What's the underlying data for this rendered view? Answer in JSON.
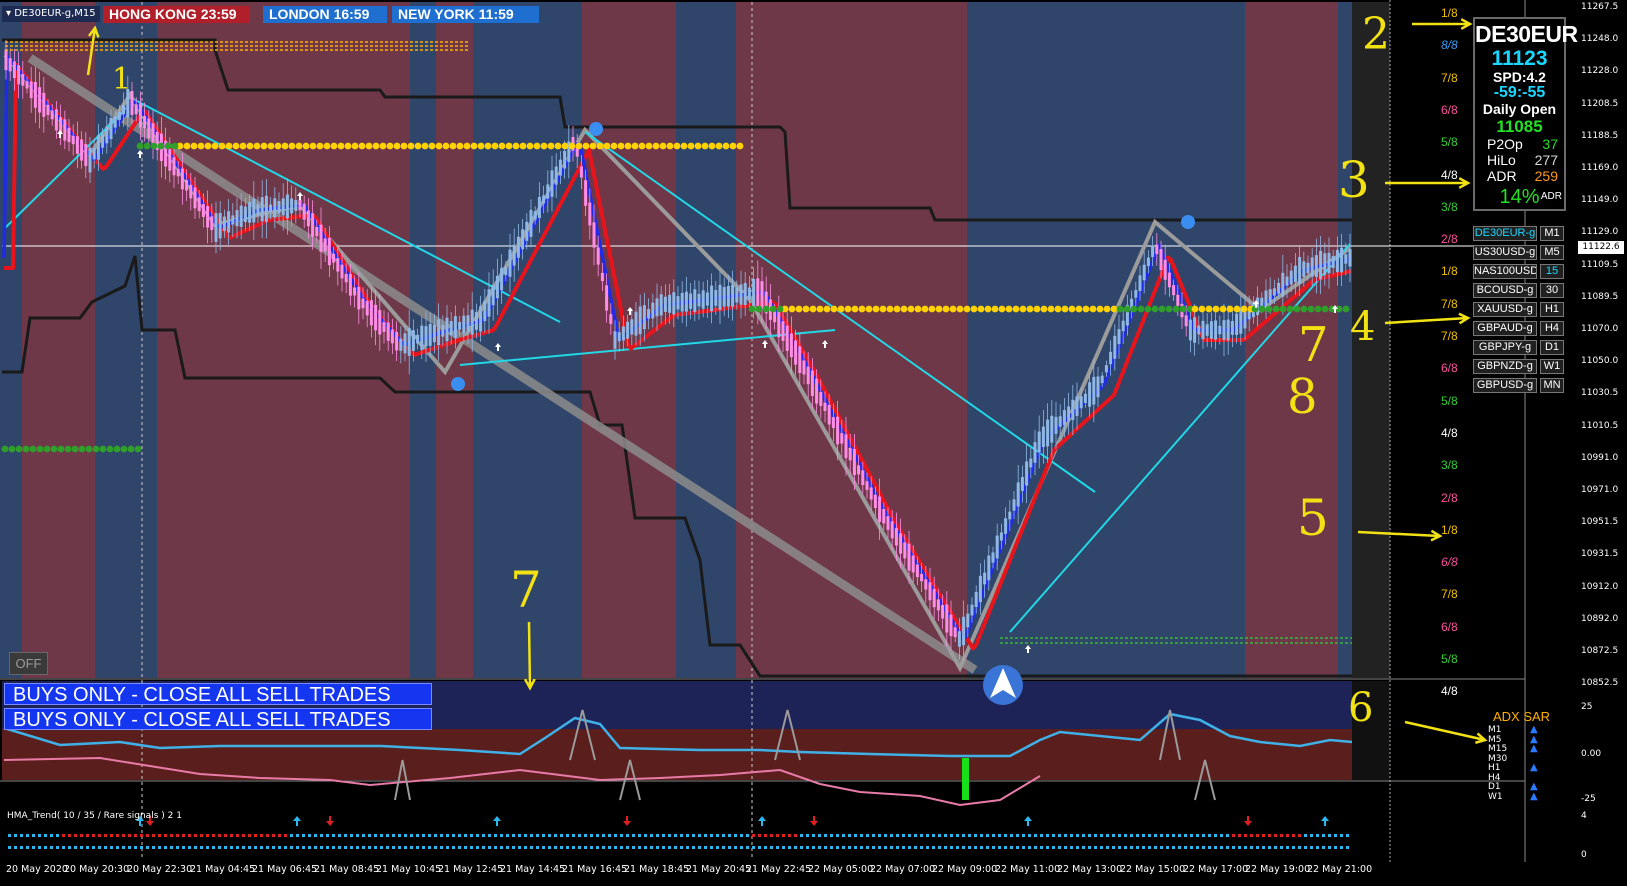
{
  "chart": {
    "symbol_timeframe": "DE30EUR-g,M15",
    "sessions": [
      {
        "city": "HONG KONG",
        "time": "23:59",
        "color": "#b01f2a"
      },
      {
        "city": "LONDON",
        "time": "16:59",
        "color": "#1e6fd0"
      },
      {
        "city": "NEW YORK",
        "time": "11:59",
        "color": "#1e6fd0"
      }
    ],
    "banners": [
      "BUYS ONLY - CLOSE ALL SELL TRADES",
      "BUYS ONLY - CLOSE ALL SELL TRADES"
    ],
    "off_button": "OFF",
    "current_price_tag": "11122.6",
    "colors": {
      "bull_bg": "#2f4569",
      "bear_bg": "#6e3848",
      "red_line": "#e8141c",
      "blue_line": "#1f2be6",
      "gray_line": "#9b9b9b",
      "cyan_line": "#22d7e6",
      "yellow_dots": "#ffd200",
      "green_dots": "#2f9e2a",
      "annotation": "#f2e214"
    }
  },
  "info_panel": {
    "symbol": "DE30EUR",
    "price": "11123",
    "spread": "SPD:4.2",
    "countdown": "-59:-55",
    "daily_open_label": "Daily Open",
    "daily_open_value": "11085",
    "rows": [
      {
        "label": "P2Op",
        "value": "37",
        "color": "#24e024"
      },
      {
        "label": "HiLo",
        "value": "277",
        "color": "#d8d8d8"
      },
      {
        "label": "ADR",
        "value": "259",
        "color": "#ff9a1a"
      }
    ],
    "adr_pct": "14%",
    "adr_suffix": "ADR"
  },
  "symbol_list": [
    "DE30EUR-g",
    "US30USD-g",
    "NAS100USD-g",
    "BCOUSD-g",
    "XAUUSD-g",
    "GBPAUD-g",
    "GBPJPY-g",
    "GBPNZD-g",
    "GBPUSD-g"
  ],
  "timeframes": [
    "M1",
    "M5",
    "15",
    "30",
    "H1",
    "H4",
    "D1",
    "W1",
    "MN"
  ],
  "price_axis": [
    "11267.5",
    "11248.0",
    "11228.0",
    "11208.5",
    "11188.5",
    "11169.0",
    "11149.0",
    "11129.0",
    "11109.5",
    "11089.5",
    "11070.0",
    "11050.0",
    "11030.5",
    "11010.5",
    "10991.0",
    "10971.0",
    "10951.5",
    "10931.5",
    "10912.0",
    "10892.0",
    "10872.5",
    "10852.5"
  ],
  "murrey_levels": [
    {
      "text": "1/8",
      "color": "#f0c000"
    },
    {
      "text": "8/8",
      "color": "#3aa0ff",
      "italic": true
    },
    {
      "text": "7/8",
      "color": "#f0c000"
    },
    {
      "text": "6/8",
      "color": "#ff4fa0"
    },
    {
      "text": "5/8",
      "color": "#30d030"
    },
    {
      "text": "4/8",
      "color": "#ffffff"
    },
    {
      "text": "3/8",
      "color": "#30d030"
    },
    {
      "text": "2/8",
      "color": "#ff4fa0"
    },
    {
      "text": "1/8",
      "color": "#f0c000"
    },
    {
      "text": "7/8",
      "color": "#f0c000"
    },
    {
      "text": "7/8",
      "color": "#f0c000"
    },
    {
      "text": "6/8",
      "color": "#ff4fa0"
    },
    {
      "text": "5/8",
      "color": "#30d030"
    },
    {
      "text": "4/8",
      "color": "#ffffff"
    },
    {
      "text": "3/8",
      "color": "#30d030"
    },
    {
      "text": "2/8",
      "color": "#ff4fa0"
    },
    {
      "text": "1/8",
      "color": "#f0c000"
    },
    {
      "text": "6/8",
      "color": "#ff4fa0",
      "italic": true
    },
    {
      "text": "7/8",
      "color": "#f0c000"
    },
    {
      "text": "6/8",
      "color": "#ff4fa0"
    },
    {
      "text": "5/8",
      "color": "#30d030"
    },
    {
      "text": "4/8",
      "color": "#ffffff"
    }
  ],
  "adx": {
    "title": "ADX SAR",
    "rows": [
      "M1",
      "M5",
      "M15",
      "M30",
      "H1",
      "H4",
      "D1",
      "W1"
    ],
    "axis": [
      "25",
      "0.00",
      "-25"
    ]
  },
  "hma": {
    "label": "HMA_Trend( 10 / 35 / Rare signals ) 2 1",
    "axis": [
      "4",
      "0"
    ]
  },
  "time_axis": [
    "20 May 2020",
    "20 May 20:30",
    "20 May 22:30",
    "21 May 04:45",
    "21 May 06:45",
    "21 May 08:45",
    "21 May 10:45",
    "21 May 12:45",
    "21 May 14:45",
    "21 May 16:45",
    "21 May 18:45",
    "21 May 20:45",
    "21 May 22:45",
    "22 May 05:00",
    "22 May 07:00",
    "22 May 09:00",
    "22 May 11:00",
    "22 May 13:00",
    "22 May 15:00",
    "22 May 17:00",
    "22 May 19:00",
    "22 May 21:00"
  ],
  "annotations": [
    "1",
    "2",
    "3",
    "4",
    "5",
    "6",
    "7",
    "8",
    "7"
  ]
}
